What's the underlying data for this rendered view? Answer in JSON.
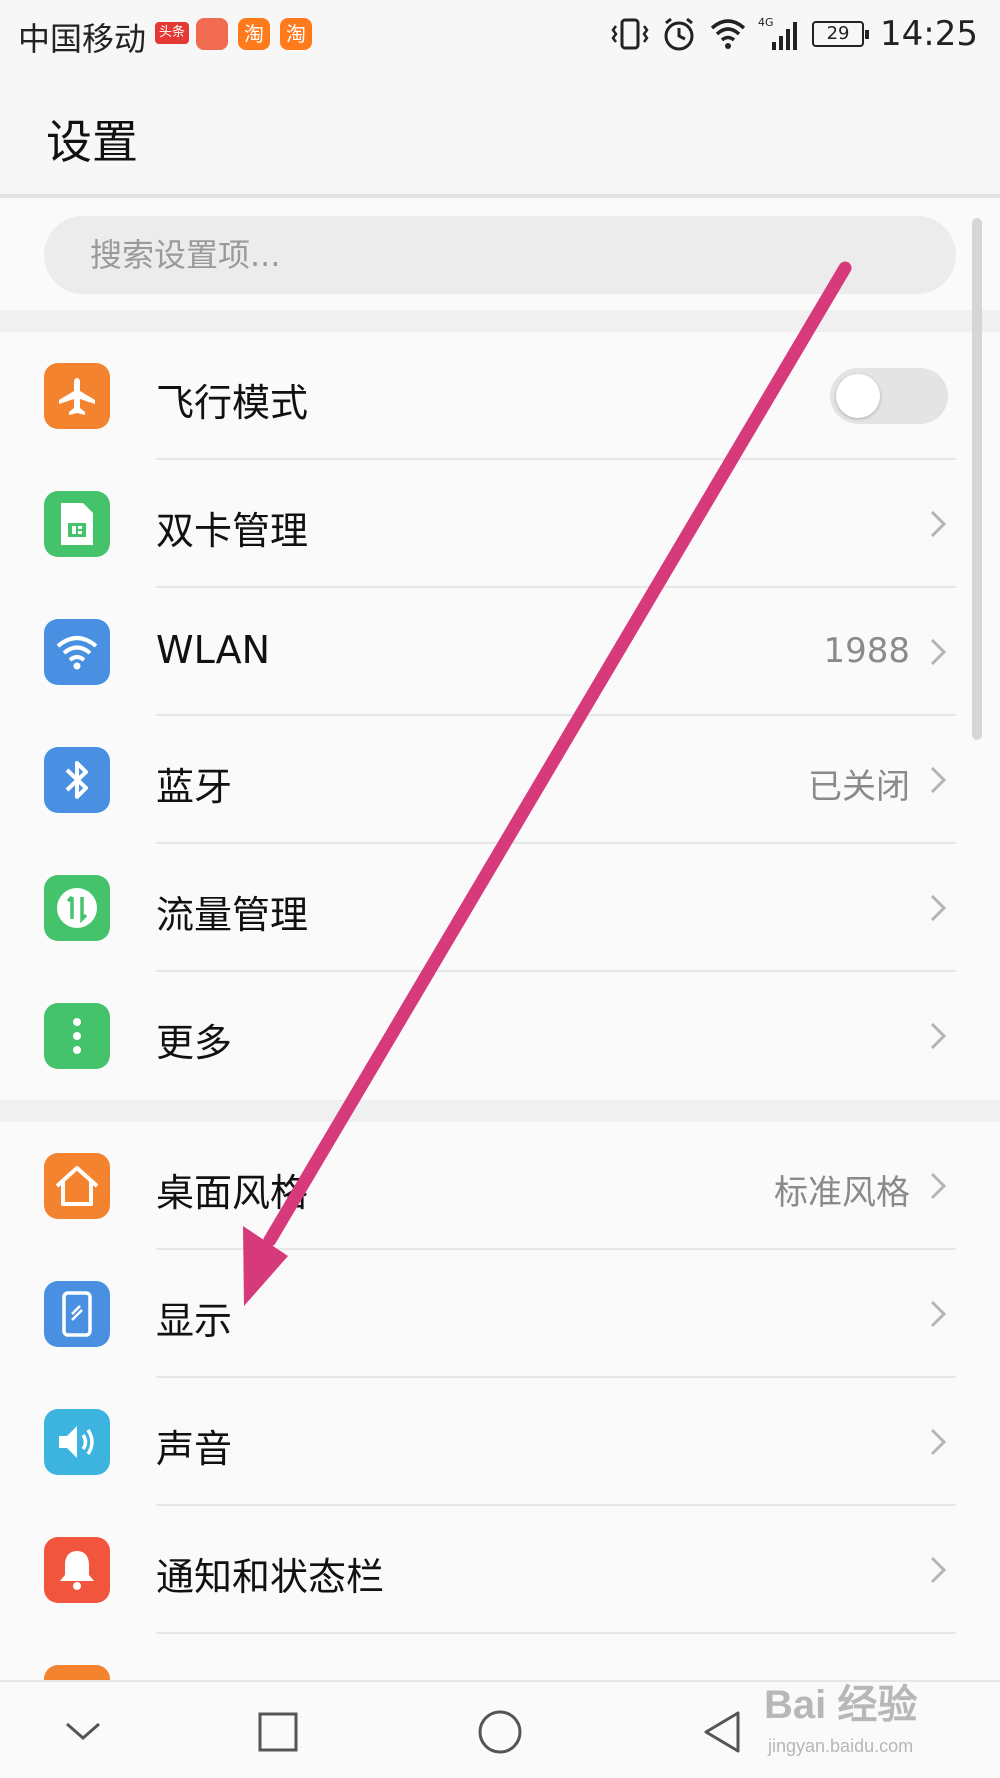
{
  "status_bar": {
    "carrier": "中国移动",
    "app_badges": [
      "头条",
      "淘",
      "淘"
    ],
    "battery": "29",
    "network": "4G",
    "time": "14:25"
  },
  "header": {
    "title": "设置"
  },
  "search": {
    "placeholder": "搜索设置项..."
  },
  "groups": [
    {
      "items": [
        {
          "label": "飞行模式",
          "icon": "airplane-icon",
          "icon_color": "#f4832f",
          "control": "toggle",
          "toggle_on": false
        },
        {
          "label": "双卡管理",
          "icon": "sim-card-icon",
          "icon_color": "#45c36c",
          "control": "chevron"
        },
        {
          "label": "WLAN",
          "value": "1988",
          "icon": "wifi-icon",
          "icon_color": "#4a90e2",
          "control": "chevron"
        },
        {
          "label": "蓝牙",
          "value": "已关闭",
          "icon": "bluetooth-icon",
          "icon_color": "#4a90e2",
          "control": "chevron"
        },
        {
          "label": "流量管理",
          "icon": "data-usage-icon",
          "icon_color": "#45c36c",
          "control": "chevron"
        },
        {
          "label": "更多",
          "icon": "more-dots-icon",
          "icon_color": "#45c36c",
          "control": "chevron"
        }
      ]
    },
    {
      "items": [
        {
          "label": "桌面风格",
          "value": "标准风格",
          "icon": "home-icon",
          "icon_color": "#f4832f",
          "control": "chevron"
        },
        {
          "label": "显示",
          "icon": "display-icon",
          "icon_color": "#4a90e2",
          "control": "chevron"
        },
        {
          "label": "声音",
          "icon": "sound-icon",
          "icon_color": "#3db4e0",
          "control": "chevron"
        },
        {
          "label": "通知和状态栏",
          "icon": "bell-icon",
          "icon_color": "#f2553d",
          "control": "chevron"
        }
      ]
    }
  ],
  "annotation": {
    "color": "#d63a7a"
  },
  "navbar": {
    "buttons": [
      "collapse-icon",
      "recent-apps-icon",
      "home-circle-icon",
      "back-triangle-icon"
    ]
  },
  "watermark": {
    "text": "Bai 经验",
    "url": "jingyan.baidu.com"
  }
}
